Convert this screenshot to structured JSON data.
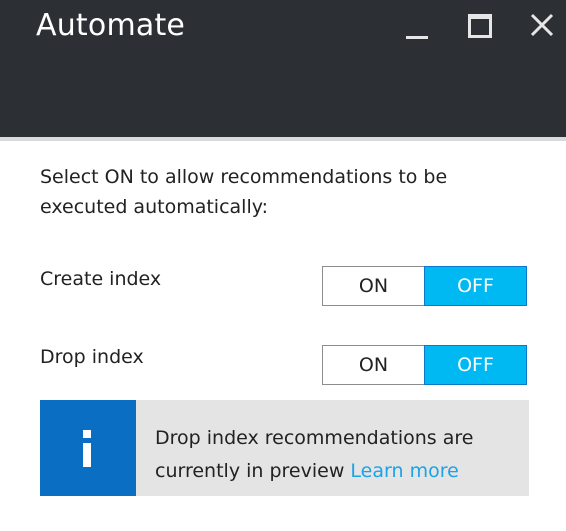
{
  "window": {
    "title": "Automate",
    "controls": [
      "minimize-icon",
      "maximize-icon",
      "close-icon"
    ],
    "header_color": "#2c3035"
  },
  "description": "Select ON to allow recommendations to be executed automatically:",
  "settings": [
    {
      "label": "Create index",
      "on_label": "ON",
      "off_label": "OFF",
      "selected": "OFF"
    },
    {
      "label": "Drop index",
      "on_label": "ON",
      "off_label": "OFF",
      "selected": "OFF"
    }
  ],
  "info": {
    "icon": "info-icon",
    "message": "Drop index recommendations are currently in preview",
    "link_text": "Learn more"
  },
  "colors": {
    "accent": "#00b9f2",
    "info_icon_bg": "#0a6fc2",
    "link": "#1aa3e8",
    "info_bg": "#e4e4e4"
  }
}
